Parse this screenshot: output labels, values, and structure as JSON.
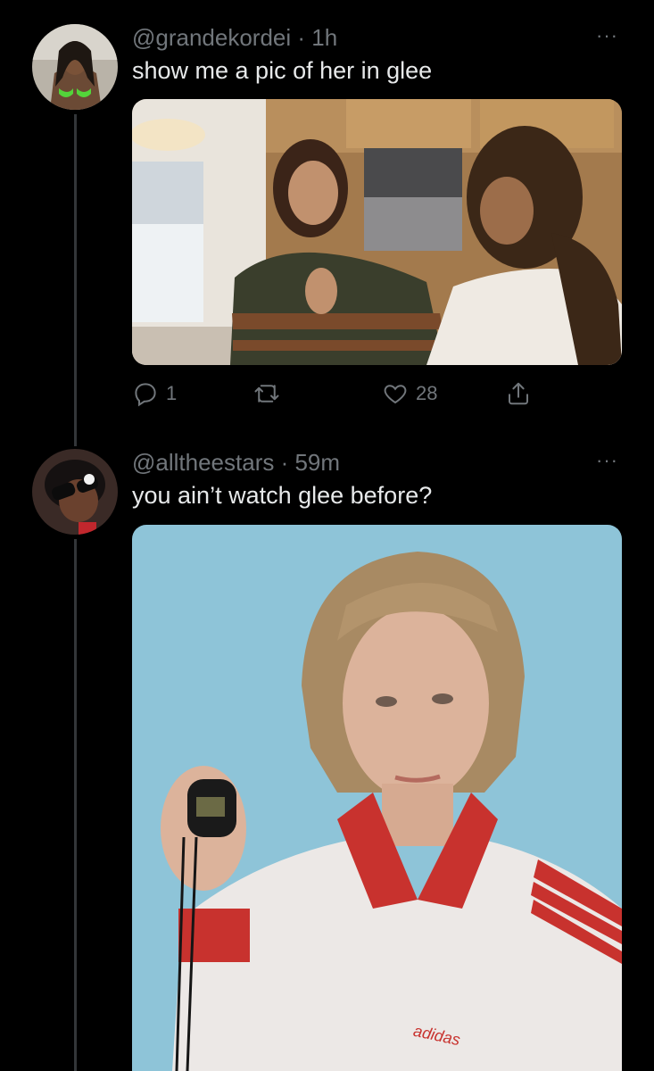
{
  "tweets": [
    {
      "handle": "@grandekordei",
      "time": "1h",
      "text": "show me a pic of her in glee",
      "media_description": "",
      "actions": {
        "replies": "1",
        "retweets": "",
        "likes": "28"
      }
    },
    {
      "handle": "@alltheestars",
      "time": "59m",
      "text": "you ain’t watch glee before?",
      "media_brand_text": "adidas"
    }
  ],
  "more_label": "···",
  "colors": {
    "background": "#000000",
    "text": "#e7e9ea",
    "muted": "#71767b",
    "thread": "#333639"
  }
}
